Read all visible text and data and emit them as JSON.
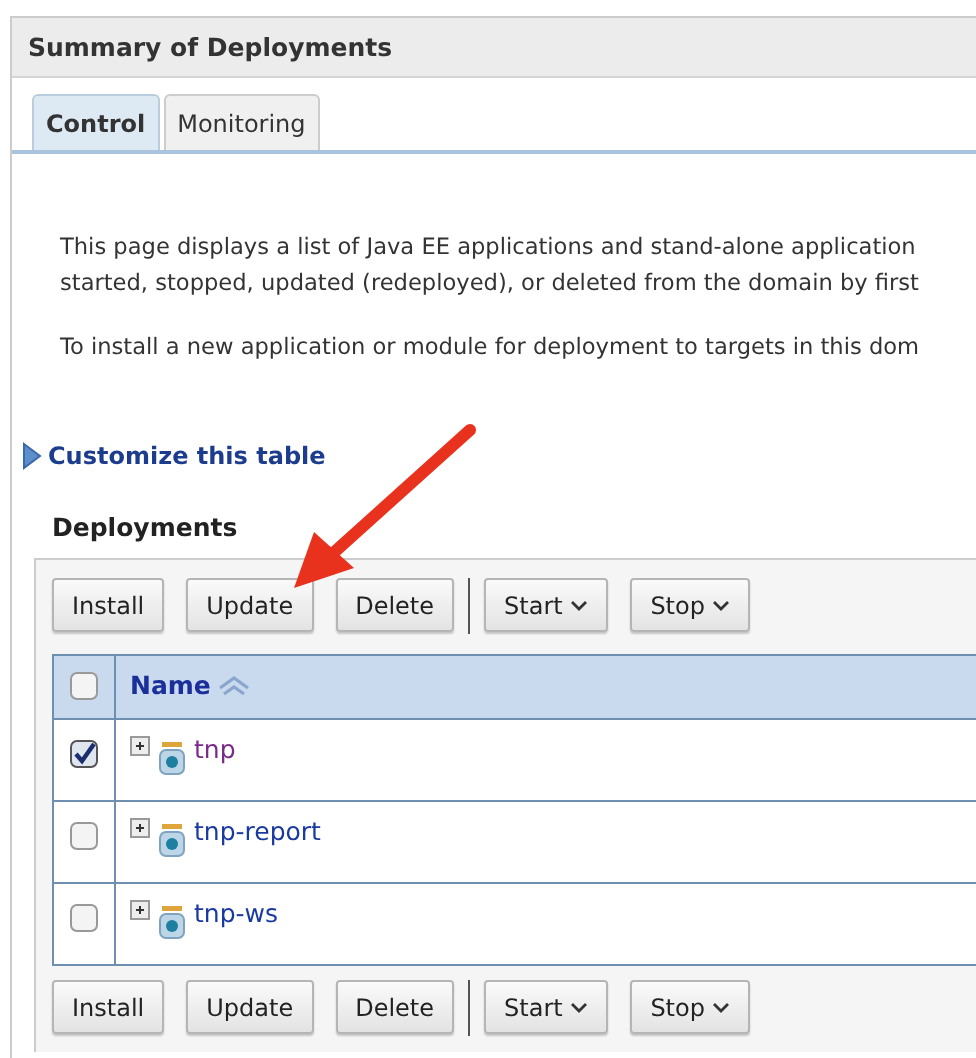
{
  "panel": {
    "title": "Summary of Deployments"
  },
  "tabs": [
    {
      "label": "Control",
      "selected": true
    },
    {
      "label": "Monitoring",
      "selected": false
    }
  ],
  "intro": [
    "This page displays a list of Java EE applications and stand-alone application",
    "started, stopped, updated (redeployed), or deleted from the domain by first",
    "To install a new application or module for deployment to targets in this dom"
  ],
  "customize_link": "Customize this table",
  "table": {
    "title": "Deployments",
    "top_buttons": [
      {
        "label": "Install",
        "kind": "plain"
      },
      {
        "label": "Update",
        "kind": "plain"
      },
      {
        "label": "Delete",
        "kind": "plain"
      },
      {
        "label": "Start",
        "kind": "menu"
      },
      {
        "label": "Stop",
        "kind": "menu"
      }
    ],
    "columns": [
      {
        "label": "Name",
        "sorted": true
      }
    ],
    "select_all": {
      "checked": false
    },
    "rows": [
      {
        "name": "tnp",
        "checked": true,
        "visited": true
      },
      {
        "name": "tnp-report",
        "checked": false,
        "visited": false
      },
      {
        "name": "tnp-ws",
        "checked": false,
        "visited": false
      }
    ],
    "bottom_buttons": [
      {
        "label": "Install",
        "kind": "plain"
      },
      {
        "label": "Update",
        "kind": "plain"
      },
      {
        "label": "Delete",
        "kind": "plain"
      },
      {
        "label": "Start",
        "kind": "menu"
      },
      {
        "label": "Stop",
        "kind": "menu"
      }
    ]
  }
}
